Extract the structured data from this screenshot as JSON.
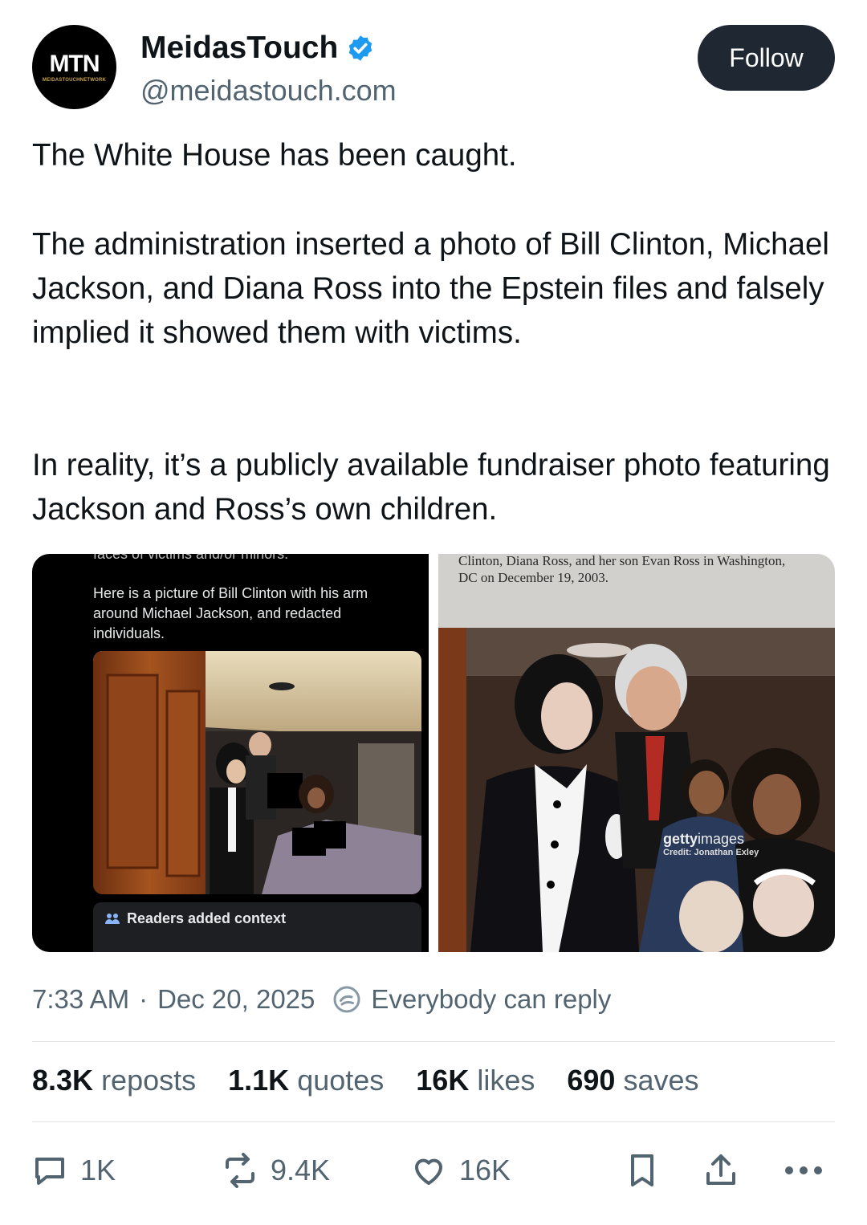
{
  "author": {
    "name": "MeidasTouch",
    "handle": "@meidastouch.com",
    "avatar_text": "MTN",
    "avatar_subtext": "MEIDASTOUCHNETWORK"
  },
  "follow_label": "Follow",
  "post": {
    "p1": "The White House has been caught.",
    "p2": "The administration inserted a photo of Bill Clinton, Michael Jackson, and Diana Ross into the Epstein files and falsely implied it showed them with victims.",
    "p3": "In reality, it’s a publicly available fundraiser photo featuring Jackson and Ross’s own children."
  },
  "media": {
    "left_top_cut": "faces of victims and/or minors.",
    "left_caption": "Here is a picture of Bill Clinton with his arm around Michael Jackson, and redacted individuals.",
    "context_label": "Readers added context",
    "right_caption": "Clinton, Diana Ross, and her son Evan Ross in Washington, DC on December 19, 2003.",
    "watermark_a": "getty",
    "watermark_b": "images",
    "credit": "Credit: Jonathan Exley"
  },
  "meta": {
    "time": "7:33 AM",
    "sep": "·",
    "date": "Dec 20, 2025",
    "reply_setting": "Everybody can reply"
  },
  "stats": {
    "reposts_count": "8.3K",
    "reposts_label": "reposts",
    "quotes_count": "1.1K",
    "quotes_label": "quotes",
    "likes_count": "16K",
    "likes_label": "likes",
    "saves_count": "690",
    "saves_label": "saves"
  },
  "actions": {
    "replies": "1K",
    "reposts": "9.4K",
    "likes": "16K"
  },
  "colors": {
    "verified": "#1d9bf0",
    "follow_bg": "#1f2732",
    "secondary_text": "#536471"
  }
}
